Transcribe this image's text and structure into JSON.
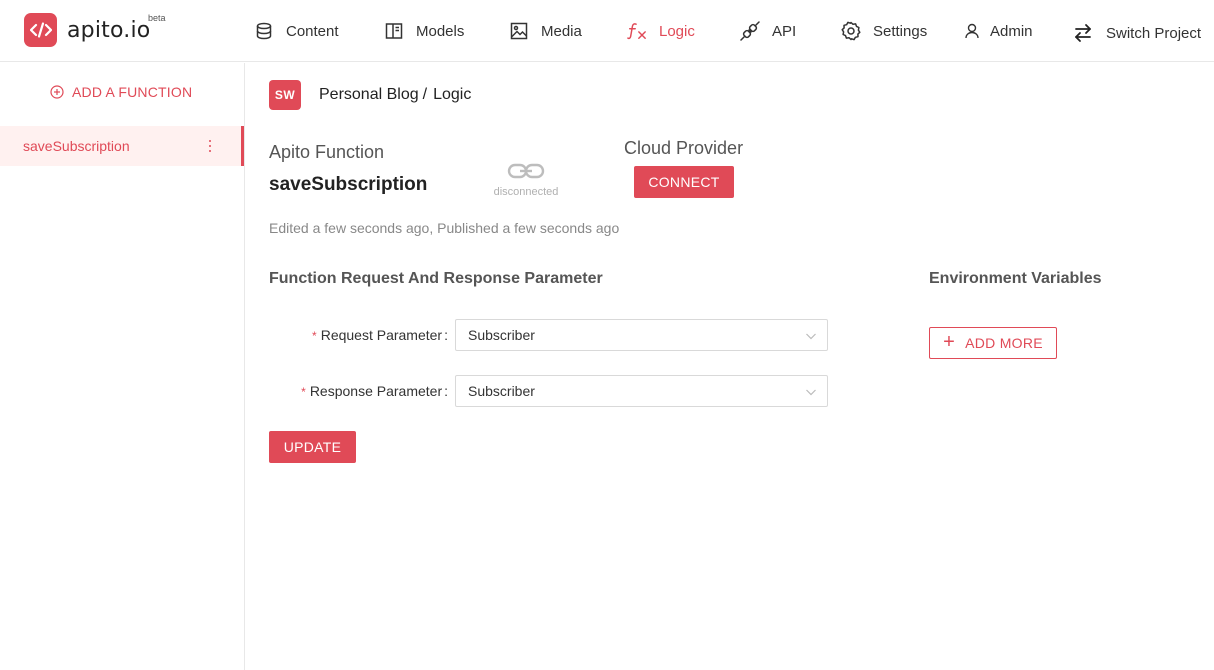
{
  "brand": {
    "name": "apito.io",
    "tag": "beta"
  },
  "nav": {
    "content": "Content",
    "models": "Models",
    "media": "Media",
    "logic": "Logic",
    "api": "API",
    "settings": "Settings",
    "admin": "Admin",
    "switch_project": "Switch Project"
  },
  "sidebar": {
    "add_function": "ADD A FUNCTION",
    "functions": [
      {
        "name": "saveSubscription",
        "active": true
      }
    ]
  },
  "project": {
    "badge": "SW",
    "name": "Personal Blog",
    "separator": "/",
    "section": "Logic"
  },
  "function": {
    "label": "Apito Function",
    "name": "saveSubscription",
    "status": "disconnected",
    "cloud_label": "Cloud Provider",
    "connect_label": "CONNECT",
    "edited_text": "Edited a few seconds ago, Published a few seconds ago"
  },
  "form": {
    "title": "Function Request And Response Parameter",
    "required_mark": "*",
    "request_label": "Request Parameter",
    "request_value": "Subscriber",
    "response_label": "Response Parameter",
    "response_value": "Subscriber",
    "colon": ":",
    "update_label": "UPDATE"
  },
  "env": {
    "title": "Environment Variables",
    "add_more_label": "ADD MORE"
  },
  "colors": {
    "accent": "#e04a57",
    "active_bg": "#fff1f0"
  }
}
